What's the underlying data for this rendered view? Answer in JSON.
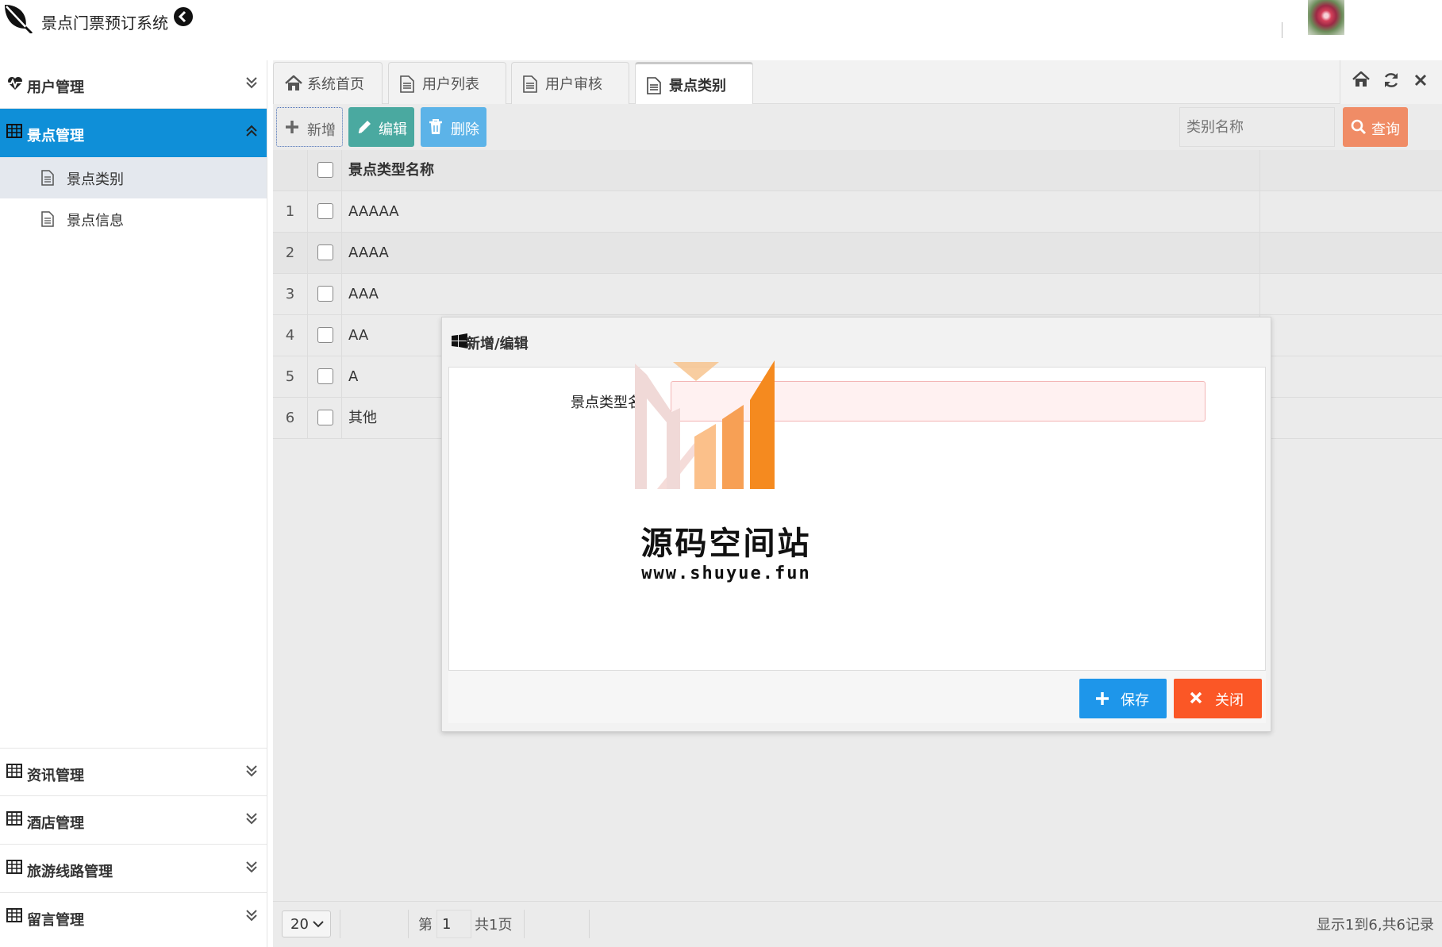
{
  "header": {
    "app_title": "景点门票预订系统"
  },
  "sidebar": {
    "groups": [
      {
        "label": "用户管理",
        "icon": "heartbeat-icon",
        "expanded": false
      },
      {
        "label": "景点管理",
        "icon": "table-icon",
        "expanded": true,
        "items": [
          {
            "label": "景点类别",
            "selected": true
          },
          {
            "label": "景点信息",
            "selected": false
          }
        ]
      },
      {
        "label": "资讯管理",
        "icon": "table-icon",
        "expanded": false
      },
      {
        "label": "酒店管理",
        "icon": "table-icon",
        "expanded": false
      },
      {
        "label": "旅游线路管理",
        "icon": "table-icon",
        "expanded": false
      },
      {
        "label": "留言管理",
        "icon": "table-icon",
        "expanded": false
      }
    ]
  },
  "tabs": [
    {
      "label": "系统首页",
      "icon": "home-icon",
      "active": false
    },
    {
      "label": "用户列表",
      "icon": "document-icon",
      "active": false
    },
    {
      "label": "用户审核",
      "icon": "document-icon",
      "active": false
    },
    {
      "label": "景点类别",
      "icon": "document-icon",
      "active": true
    }
  ],
  "toolbar": {
    "add_label": "新增",
    "edit_label": "编辑",
    "delete_label": "删除",
    "search_placeholder": "类别名称",
    "query_label": "查询"
  },
  "grid": {
    "column_header": "景点类型名称",
    "rows": [
      {
        "num": "1",
        "name": "AAAAA"
      },
      {
        "num": "2",
        "name": "AAAA"
      },
      {
        "num": "3",
        "name": "AAA"
      },
      {
        "num": "4",
        "name": "AA"
      },
      {
        "num": "5",
        "name": "A"
      },
      {
        "num": "6",
        "name": "其他"
      }
    ]
  },
  "pager": {
    "page_size": "20",
    "page_prefix": "第",
    "page_value": "1",
    "page_suffix": "共1页",
    "record_info": "显示1到6,共6记录"
  },
  "dialog": {
    "title": "新增/编辑",
    "field_label": "景点类型名称",
    "field_value": "",
    "save_label": "保存",
    "close_label": "关闭"
  },
  "watermark": {
    "title": "源码空间站",
    "url": "www.shuyue.fun"
  },
  "colors": {
    "sidebar_active": "#0f8fd8",
    "edit_button": "#4aa9a0",
    "delete_button": "#5cb3e8",
    "query_button": "#f08c66",
    "save_button": "#1e96ea",
    "close_button": "#fb5726"
  }
}
